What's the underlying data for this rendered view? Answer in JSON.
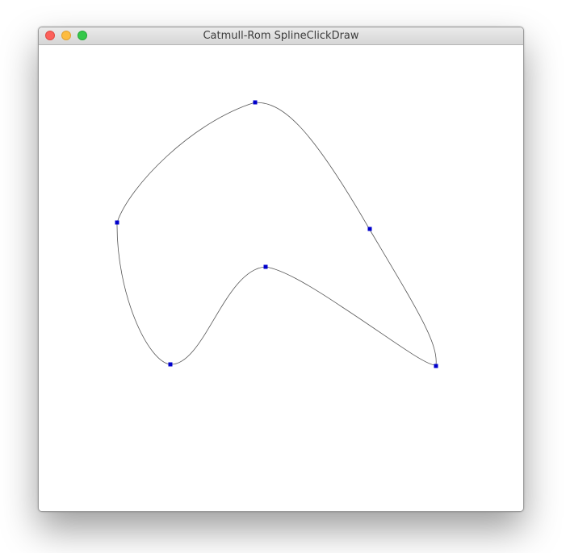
{
  "window": {
    "title": "Catmull-Rom SplineClickDraw"
  },
  "colors": {
    "curve": "#555555",
    "control_point": "#0000cc"
  },
  "icons": {
    "close": "close-dot-icon",
    "minimize": "minimize-dot-icon",
    "zoom": "zoom-dot-icon"
  }
}
